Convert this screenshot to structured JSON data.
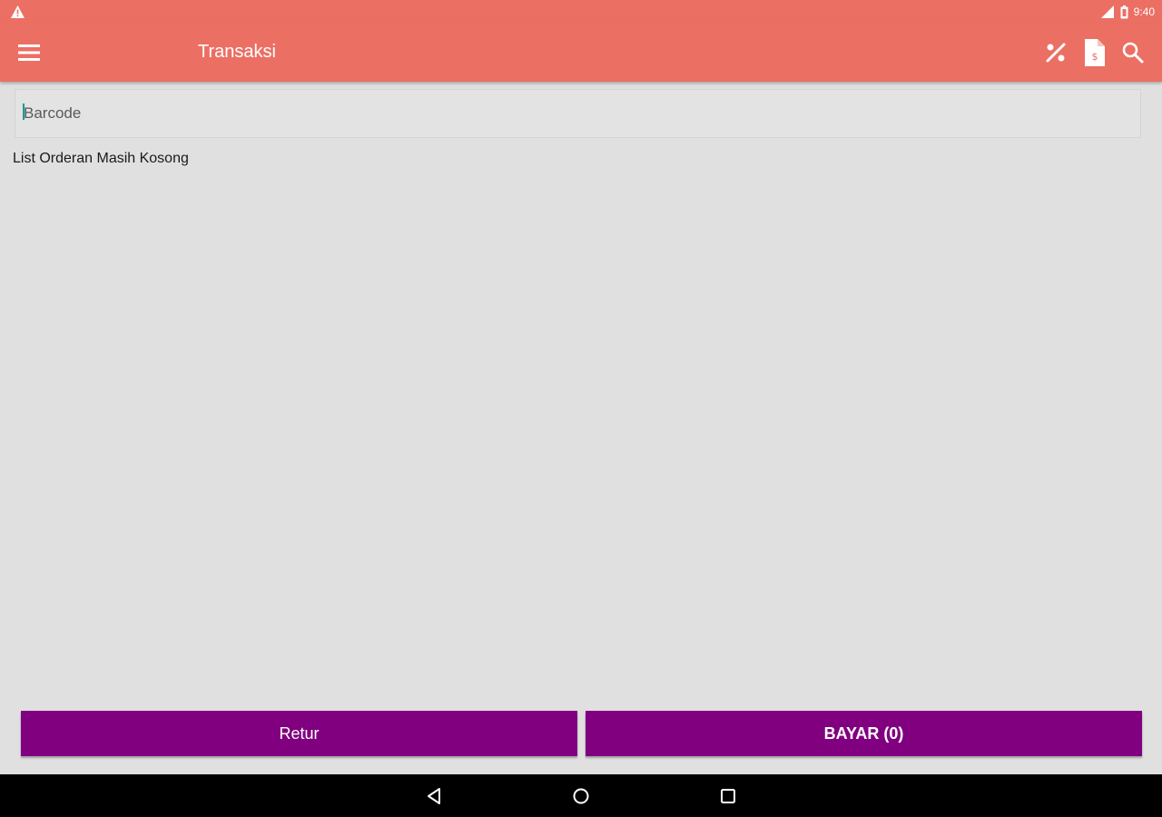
{
  "status_bar": {
    "time": "9:40",
    "warning_icon": "warning-icon",
    "signal_icon": "signal-icon",
    "battery_icon": "battery-icon"
  },
  "app_bar": {
    "title": "Transaksi",
    "background_color": "#ec6f64",
    "menu_icon": "hamburger-menu-icon",
    "actions": [
      "discount-icon",
      "invoice-icon",
      "search-icon"
    ]
  },
  "barcode": {
    "placeholder": "Barcode",
    "value": ""
  },
  "order_list": {
    "empty_message": "List Orderan Masih Kosong"
  },
  "buttons": {
    "retur_label": "Retur",
    "bayar_label": "BAYAR (0)",
    "color": "#800080"
  },
  "nav_bar": {
    "icons": [
      "back-icon",
      "home-icon",
      "recent-apps-icon"
    ]
  }
}
